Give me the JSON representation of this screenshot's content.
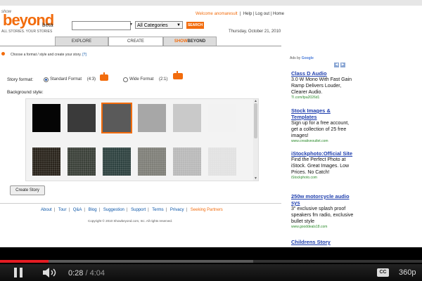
{
  "site": {
    "logo_small": "show",
    "logo_big": "beyond",
    "logo_beta": "beta",
    "tagline": "ALL STORIES. YOUR STORIES"
  },
  "header": {
    "welcome": "Welcome anomaresult",
    "help": "Help",
    "logout": "Log out",
    "home": "Home",
    "date": "Thursday, October 21, 2010",
    "search_value": "",
    "category": "All Categories",
    "search_button": "SEARCH"
  },
  "tabs": [
    {
      "label": "EXPLORE"
    },
    {
      "label": "CREATE"
    },
    {
      "label_prefix": "SHOW",
      "label_suffix": "BEYOND"
    }
  ],
  "create": {
    "hint": "Choose a format / style and create your story.",
    "hint_link": "[?]",
    "format_label": "Story format:",
    "standard_label": "Standard Format",
    "standard_ratio": "(4:3)",
    "wide_label": "Wide Format",
    "wide_ratio": "(2:1)",
    "standard_selected": true,
    "background_label": "Background style:",
    "selected_tile": 2,
    "create_button": "Create Story"
  },
  "tiles": [
    {
      "name": "bg-black",
      "color": "#050505"
    },
    {
      "name": "bg-dark-grey",
      "color": "#3a3a3a"
    },
    {
      "name": "bg-charcoal",
      "color": "#5a5a5a"
    },
    {
      "name": "bg-mid-grey",
      "color": "#a7a7a7"
    },
    {
      "name": "bg-light-grey",
      "color": "#c9c9c9"
    },
    {
      "name": "bg-white",
      "color": "#f2f2f2"
    },
    {
      "name": "bg-granite-black",
      "color": "#2a241c"
    },
    {
      "name": "bg-granite-green",
      "color": "#3a4038"
    },
    {
      "name": "bg-marble-green",
      "color": "#2e4240"
    },
    {
      "name": "bg-stone-grey",
      "color": "#7f7f78"
    },
    {
      "name": "bg-lined-grey",
      "color": "#b9b9b9"
    },
    {
      "name": "bg-crumpled-paper",
      "color": "#e2e2e2"
    }
  ],
  "footer": {
    "links": [
      "About",
      "Tour",
      "Q&A",
      "Blog",
      "Suggestion",
      "Support",
      "Terms",
      "Privacy"
    ],
    "partners": "Seeking Partners",
    "copyright": "Copyright © 2010 Showbeyond.com, Inc. All rights reserved."
  },
  "ads": {
    "label": "Ads by",
    "brand": "Google",
    "items": [
      {
        "title": "Class D Audio",
        "desc": "3.0 W Mono With Fast Gain Ramp Delivers Louder, Clearer Audio.",
        "url": "TI.com/tpa2026d1"
      },
      {
        "title": "Stock Images & Templates",
        "desc": "Sign up for a free account, get a collection of 25 free images!",
        "url": "www.creativeoutlet.com"
      },
      {
        "title": "iStockphoto:Official Site",
        "desc": "Find the Perfect Photo at iStock. Great Images. Low Prices. No Catch!",
        "url": "iStockphoto.com"
      },
      {
        "title": "250w motorcycle audio sys",
        "desc": "3\" exclusive splash proof speakers fm radio, exclusive bullet style",
        "url": "www.gooddeals18.com"
      },
      {
        "title": "Childrens Story",
        "desc": "",
        "url": ""
      }
    ]
  },
  "player": {
    "current_time": "0:28",
    "total_time": "4:04",
    "progress": 0.1148,
    "quality": "360p",
    "cc": "CC"
  },
  "colors": {
    "brand_orange": "#f26c0d",
    "link_blue": "#0a55a8",
    "progress_red": "#e51c23"
  }
}
